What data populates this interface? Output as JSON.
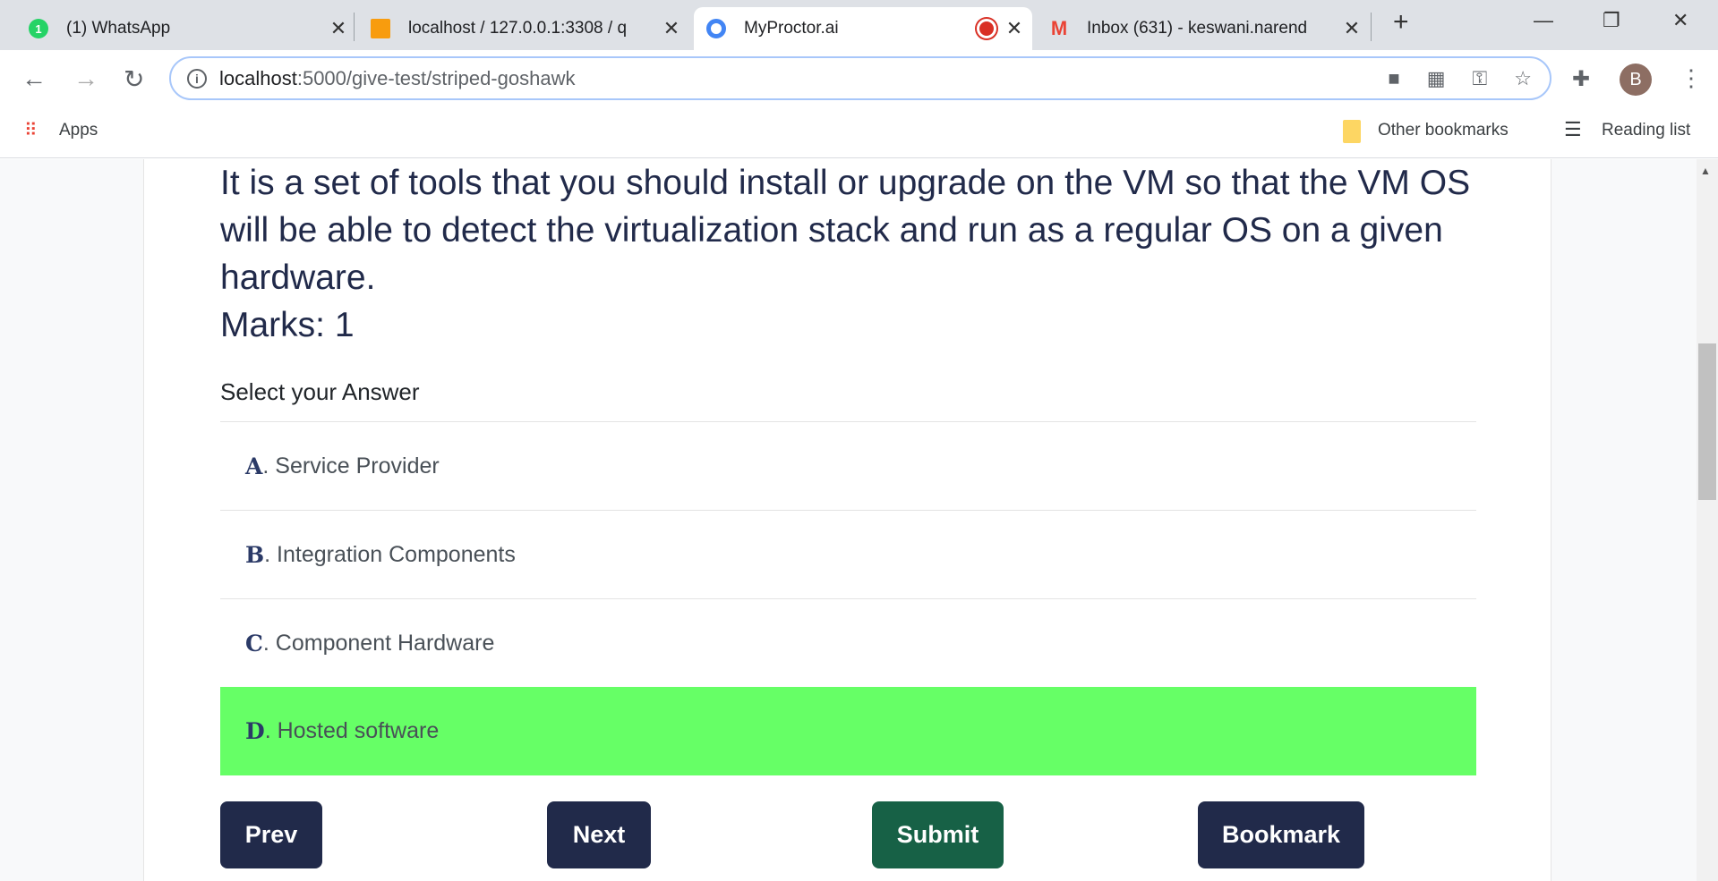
{
  "browser": {
    "tabs": [
      {
        "title": "(1) WhatsApp",
        "icon": "whatsapp-icon",
        "badge": "1"
      },
      {
        "title": "localhost / 127.0.0.1:3308 / q",
        "icon": "phpmyadmin-icon"
      },
      {
        "title": "MyProctor.ai",
        "icon": "chrome-icon",
        "active": true
      },
      {
        "title": "Inbox (631) - keswani.narend",
        "icon": "gmail-icon"
      }
    ],
    "url_host": "localhost",
    "url_path": ":5000/give-test/striped-goshawk",
    "profile_initial": "B",
    "bookmarks": {
      "apps": "Apps",
      "other": "Other bookmarks",
      "reading": "Reading list"
    }
  },
  "question": {
    "text": "It is a set of tools that you should install or upgrade on the VM so that the VM OS will be able to detect the virtualization stack and run as a regular OS on a given hardware.",
    "marks": "Marks: 1",
    "prompt": "Select your Answer",
    "options": [
      {
        "letter": "A",
        "text": ". Service Provider"
      },
      {
        "letter": "B",
        "text": ". Integration Components"
      },
      {
        "letter": "C",
        "text": ". Component Hardware"
      },
      {
        "letter": "D",
        "text": ". Hosted software",
        "selected": true
      }
    ],
    "selected_color": "#66ff66"
  },
  "buttons": {
    "prev": "Prev",
    "next": "Next",
    "submit": "Submit",
    "bookmark": "Bookmark"
  }
}
